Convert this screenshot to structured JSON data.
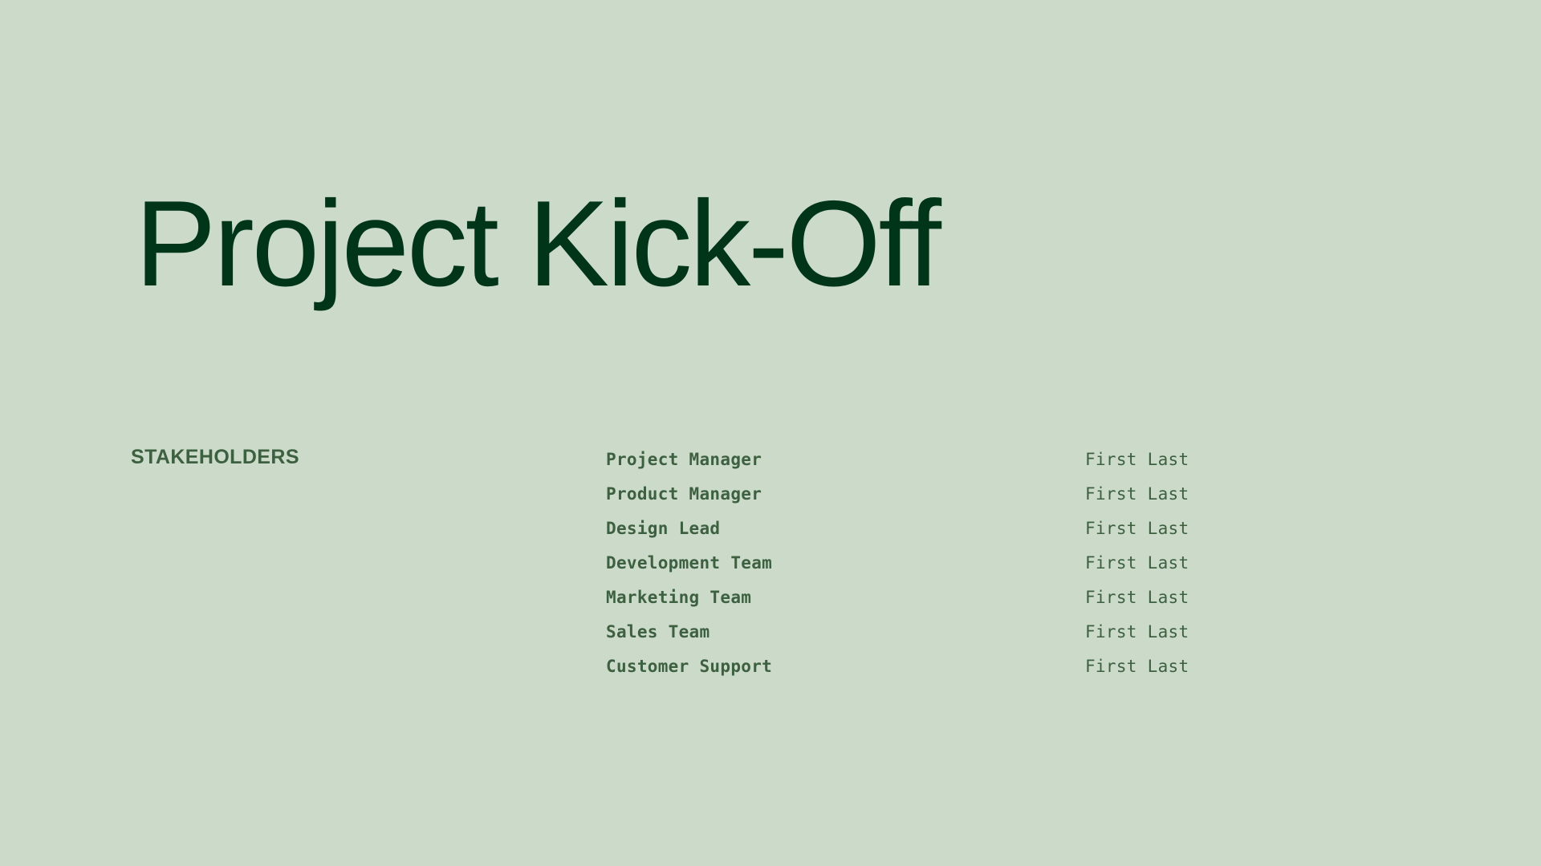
{
  "slide": {
    "title": "Project Kick-Off",
    "background_color": "#ccdbc9",
    "title_color": "#00351a",
    "body_color": "#3d6041"
  },
  "stakeholders": {
    "section_label": "STAKEHOLDERS",
    "rows": [
      {
        "role": "Project Manager",
        "name": "First Last"
      },
      {
        "role": "Product Manager",
        "name": "First Last"
      },
      {
        "role": "Design Lead",
        "name": "First Last"
      },
      {
        "role": "Development Team",
        "name": "First Last"
      },
      {
        "role": "Marketing Team",
        "name": "First Last"
      },
      {
        "role": "Sales Team",
        "name": "First Last"
      },
      {
        "role": "Customer Support",
        "name": "First Last"
      }
    ]
  }
}
